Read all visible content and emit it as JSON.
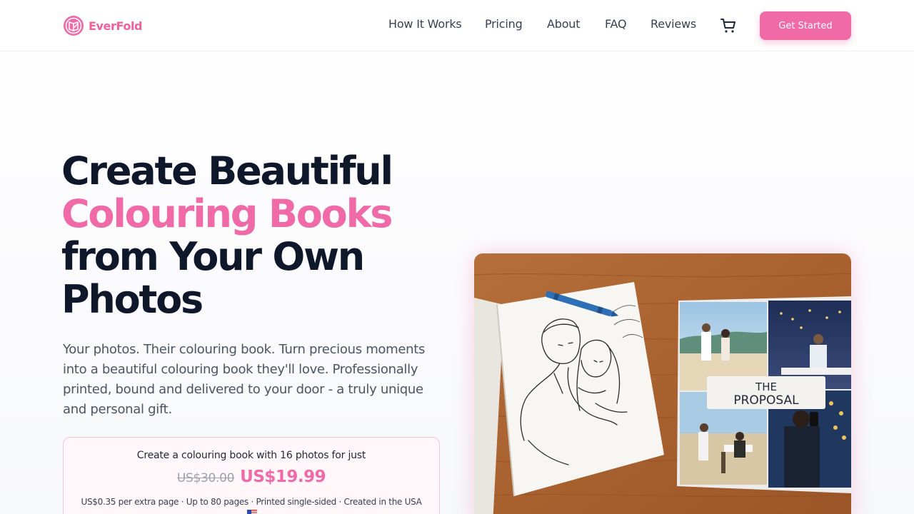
{
  "brand": {
    "name": "EverFold",
    "color": "#f06aa7"
  },
  "nav": {
    "links": [
      {
        "label": "How It Works"
      },
      {
        "label": "Pricing"
      },
      {
        "label": "About"
      },
      {
        "label": "FAQ"
      },
      {
        "label": "Reviews"
      }
    ],
    "cart_icon": "cart-icon",
    "cta_label": "Get Started"
  },
  "hero": {
    "title_line1": "Create Beautiful",
    "title_line2": "Colouring Books",
    "title_line3": "from Your Own",
    "title_line4": "Photos",
    "subtitle": "Your photos. Their colouring book. Turn precious moments into a beautiful colouring book they'll love. Professionally printed, bound and delivered to your door - a truly unique and personal gift."
  },
  "pricing": {
    "intro": "Create a colouring book with 16 photos for just",
    "old_price": "US$30.00",
    "new_price": "US$19.99",
    "note": "US$0.35 per extra page · Up to 80 pages · Printed single-sided · Created in the USA",
    "flag_icon": "us-flag-icon"
  },
  "hero_image": {
    "cover_title_line1": "THE",
    "cover_title_line2": "PROPOSAL"
  }
}
